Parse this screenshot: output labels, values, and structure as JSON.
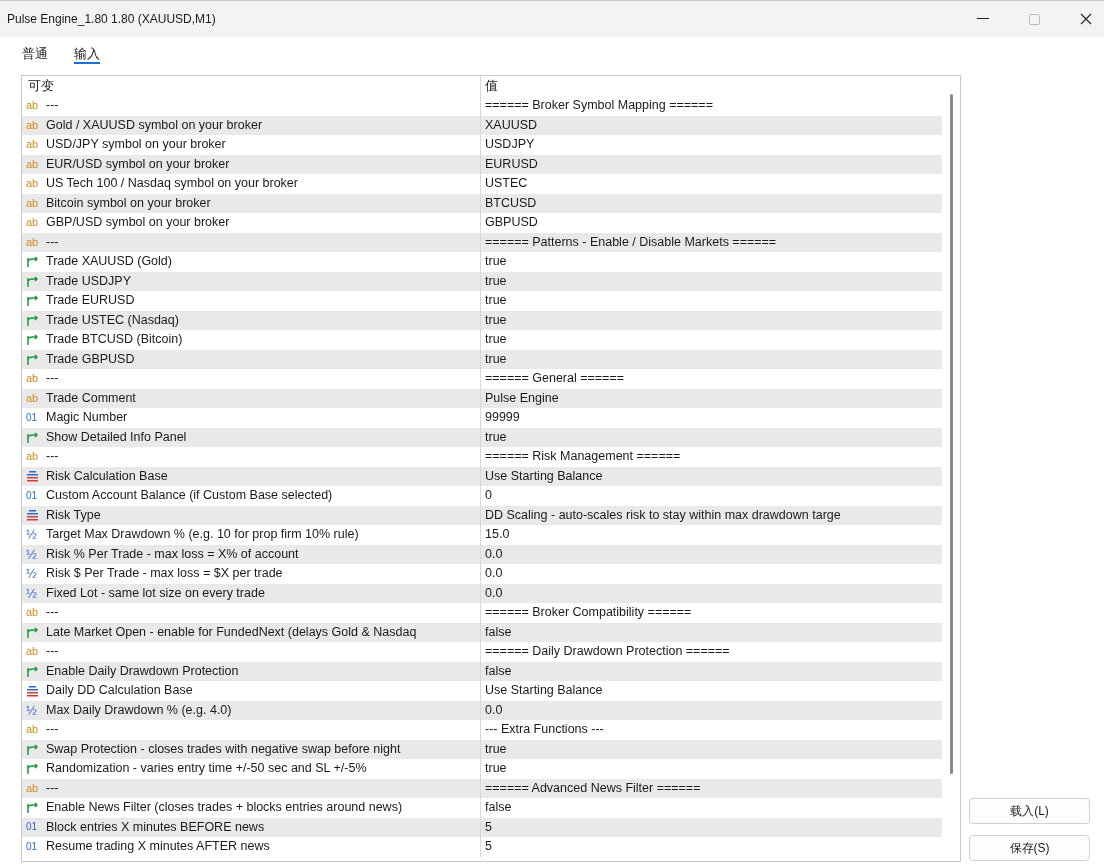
{
  "window": {
    "title": "Pulse Engine_1.80 1.80 (XAUUSD,M1)"
  },
  "tabs": [
    {
      "label": "普通",
      "selected": false
    },
    {
      "label": "输入",
      "selected": true
    }
  ],
  "table": {
    "columns": [
      "可变",
      "值"
    ],
    "rows": [
      {
        "kind": "string",
        "icon": "ab",
        "name": "---",
        "value": "====== Broker Symbol Mapping ======"
      },
      {
        "kind": "string",
        "icon": "ab",
        "name": "Gold / XAUUSD symbol on your broker",
        "value": "XAUUSD"
      },
      {
        "kind": "string",
        "icon": "ab",
        "name": "USD/JPY symbol on your broker",
        "value": "USDJPY"
      },
      {
        "kind": "string",
        "icon": "ab",
        "name": "EUR/USD symbol on your broker",
        "value": "EURUSD"
      },
      {
        "kind": "string",
        "icon": "ab",
        "name": "US Tech 100 / Nasdaq symbol on your broker",
        "value": "USTEC"
      },
      {
        "kind": "string",
        "icon": "ab",
        "name": "Bitcoin symbol on your broker",
        "value": "BTCUSD"
      },
      {
        "kind": "string",
        "icon": "ab",
        "name": "GBP/USD symbol on your broker",
        "value": "GBPUSD"
      },
      {
        "kind": "string",
        "icon": "ab",
        "name": "---",
        "value": "====== Patterns - Enable / Disable Markets ======"
      },
      {
        "kind": "bool",
        "name": "Trade XAUUSD (Gold)",
        "value": "true"
      },
      {
        "kind": "bool",
        "name": "Trade USDJPY",
        "value": "true"
      },
      {
        "kind": "bool",
        "name": "Trade EURUSD",
        "value": "true"
      },
      {
        "kind": "bool",
        "name": "Trade USTEC (Nasdaq)",
        "value": "true"
      },
      {
        "kind": "bool",
        "name": "Trade BTCUSD (Bitcoin)",
        "value": "true"
      },
      {
        "kind": "bool",
        "name": "Trade GBPUSD",
        "value": "true"
      },
      {
        "kind": "string",
        "icon": "ab",
        "name": "---",
        "value": "====== General ======"
      },
      {
        "kind": "string",
        "icon": "ab",
        "name": "Trade Comment",
        "value": "Pulse Engine"
      },
      {
        "kind": "int",
        "icon": "01",
        "name": "Magic Number",
        "value": "99999"
      },
      {
        "kind": "bool",
        "name": "Show Detailed Info Panel",
        "value": "true"
      },
      {
        "kind": "string",
        "icon": "ab",
        "name": "---",
        "value": "====== Risk Management ======"
      },
      {
        "kind": "enum",
        "name": "Risk Calculation Base",
        "value": "Use Starting Balance"
      },
      {
        "kind": "int",
        "icon": "01",
        "name": "Custom Account Balance (if Custom Base selected)",
        "value": "0"
      },
      {
        "kind": "enum",
        "name": "Risk Type",
        "value": "DD Scaling - auto-scales risk to stay within max drawdown targe"
      },
      {
        "kind": "double",
        "icon": "½",
        "name": "Target Max Drawdown % (e.g. 10 for prop firm 10% rule)",
        "value": "15.0"
      },
      {
        "kind": "double",
        "icon": "½",
        "name": "Risk % Per Trade - max loss = X% of account",
        "value": "0.0"
      },
      {
        "kind": "double",
        "icon": "½",
        "name": "Risk $ Per Trade - max loss = $X per trade",
        "value": "0.0"
      },
      {
        "kind": "double",
        "icon": "½",
        "name": "Fixed Lot - same lot size on every trade",
        "value": "0.0"
      },
      {
        "kind": "string",
        "icon": "ab",
        "name": "---",
        "value": "====== Broker Compatibility ======"
      },
      {
        "kind": "bool",
        "name": "Late Market Open - enable for FundedNext (delays Gold & Nasdaq",
        "value": "false"
      },
      {
        "kind": "string",
        "icon": "ab",
        "name": "---",
        "value": "====== Daily Drawdown Protection ======"
      },
      {
        "kind": "bool",
        "name": "Enable Daily Drawdown Protection",
        "value": "false"
      },
      {
        "kind": "enum",
        "name": "Daily DD Calculation Base",
        "value": "Use Starting Balance"
      },
      {
        "kind": "double",
        "icon": "½",
        "name": "Max Daily Drawdown % (e.g. 4.0)",
        "value": "0.0"
      },
      {
        "kind": "string",
        "icon": "ab",
        "name": "---",
        "value": "--- Extra Functions ---"
      },
      {
        "kind": "bool",
        "name": "Swap Protection - closes trades with negative swap before night",
        "value": "true"
      },
      {
        "kind": "bool",
        "name": "Randomization - varies entry time +/-50 sec and SL +/-5%",
        "value": "true"
      },
      {
        "kind": "string",
        "icon": "ab",
        "name": "---",
        "value": "====== Advanced News Filter ======"
      },
      {
        "kind": "bool",
        "name": "Enable News Filter (closes trades + blocks entries around news)",
        "value": "false"
      },
      {
        "kind": "int",
        "icon": "01",
        "name": "Block entries X minutes BEFORE news",
        "value": "5"
      },
      {
        "kind": "int",
        "icon": "01",
        "name": "Resume trading X minutes AFTER news",
        "value": "5"
      }
    ]
  },
  "buttons": [
    "载入(L)",
    "保存(S)"
  ]
}
